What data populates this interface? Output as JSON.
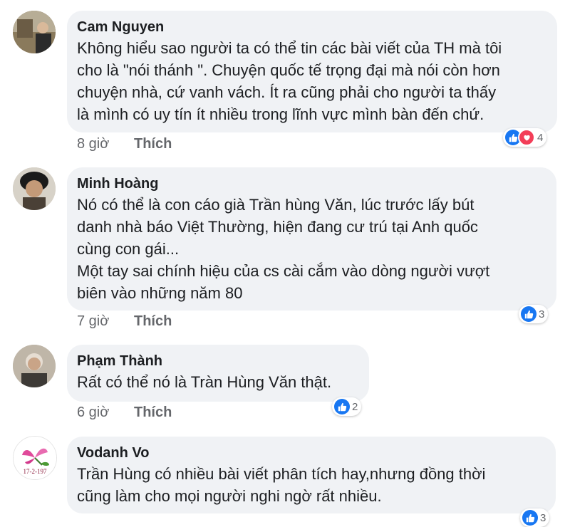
{
  "comments": [
    {
      "author": "Cam Nguyen",
      "lines": [
        "Không hiểu sao người ta có thể tin các bài viết của TH mà tôi",
        "cho là \"nói thánh \". Chuyện quốc tế trọng đại mà nói còn hơn",
        "chuyện nhà, cứ vanh vách. Ít ra cũng phải cho người ta thấy",
        "là mình có uy tín ít nhiều trong lĩnh vực mình bàn đến chứ."
      ],
      "time": "8 giờ",
      "like_label": "Thích",
      "reactions": [
        "like-icon",
        "love-icon"
      ],
      "reaction_count": "4"
    },
    {
      "author": "Minh Hoàng",
      "lines": [
        "Nó có thể là con cáo già Trần hùng Văn, lúc trước lấy bút",
        "danh nhà báo Việt Thường, hiện đang cư trú tại Anh quốc",
        "cùng con gái...",
        "Một tay sai chính hiệu của cs cài cắm vào dòng người vượt",
        "biên vào những năm 80"
      ],
      "time": "7 giờ",
      "like_label": "Thích",
      "reactions": [
        "like-icon"
      ],
      "reaction_count": "3"
    },
    {
      "author": "Phạm Thành",
      "lines": [
        "Rất có thể nó là Tràn Hùng Văn thật."
      ],
      "time": "6 giờ",
      "like_label": "Thích",
      "reactions": [
        "like-icon"
      ],
      "reaction_count": "2"
    },
    {
      "author": "Vodanh Vo",
      "lines": [
        "Trần Hùng có nhiều bài viết phân tích hay,nhưng đồng thời",
        "cũng làm cho mọi người nghi ngờ rất nhiều."
      ],
      "time": "",
      "like_label": "",
      "reactions": [
        "like-icon"
      ],
      "reaction_count": "3",
      "avatar_text": "17-2-197"
    }
  ],
  "colors": {
    "bubble": "#f0f2f5",
    "meta_text": "#65676b",
    "like_blue": "#1877f2",
    "love_red": "#f33e58"
  }
}
